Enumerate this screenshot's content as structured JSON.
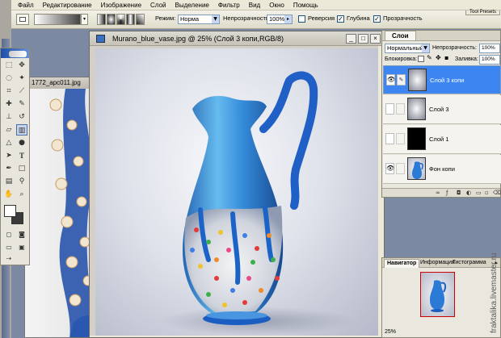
{
  "menubar": {
    "items": [
      "Файл",
      "Редактирование",
      "Изображение",
      "Слой",
      "Выделение",
      "Фильтр",
      "Вид",
      "Окно",
      "Помощь"
    ]
  },
  "options": {
    "mode_label": "Режим:",
    "mode_value": "Норма",
    "opacity_label": "Непрозрачность:",
    "opacity_value": "100%",
    "reverse_label": "Реверсия",
    "dither_label": "Глубина",
    "transparency_label": "Прозрачность",
    "brushes_tab": "Tool Presets"
  },
  "background_doc": {
    "title": "1772_apc011.jpg"
  },
  "document": {
    "title": "Murano_blue_vase.jpg @ 25% (Слой 3 копи,RGB/8)",
    "controls": {
      "minimize": "_",
      "maximize": "□",
      "close": "×"
    }
  },
  "layers_panel": {
    "tab": "Слои",
    "blend_mode": "Нормальный",
    "opacity_label": "Непрозрачность:",
    "opacity_value": "100%",
    "lock_label": "Блокировка:",
    "fill_label": "Заливка:",
    "fill_value": "100%",
    "layers": [
      {
        "name": "Слой 3 копи",
        "selected": true,
        "visible": true,
        "thumb": "gradient-light"
      },
      {
        "name": "Слой 3",
        "selected": false,
        "visible": false,
        "thumb": "gradient-light"
      },
      {
        "name": "Слой 1",
        "selected": false,
        "visible": false,
        "thumb": "black"
      },
      {
        "name": "Фон копи",
        "selected": false,
        "visible": true,
        "thumb": "vase"
      }
    ]
  },
  "navigator": {
    "tabs": [
      "Навигатор",
      "Информация",
      "Гистограмма"
    ],
    "zoom": "25%"
  },
  "watermark": "fraktalika.livemaster.ru",
  "colors": {
    "selection": "#3d86f1",
    "title_gradient": "#1b4fa8",
    "nav_frame": "#cc0000"
  }
}
